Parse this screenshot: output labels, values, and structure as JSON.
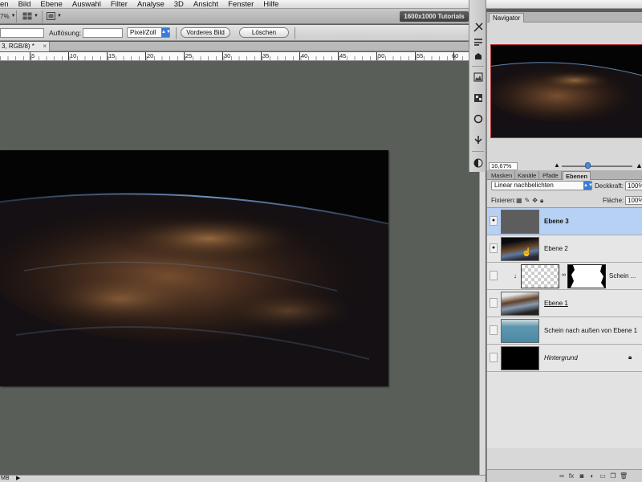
{
  "menu": [
    "en",
    "Bild",
    "Ebene",
    "Auswahl",
    "Filter",
    "Analyse",
    "3D",
    "Ansicht",
    "Fenster",
    "Hilfe"
  ],
  "appbar": {
    "zoom_fragment": "7%",
    "workspace_button": "1600x1000 Tutorials"
  },
  "options": {
    "resolution_label": "Auflösung:",
    "unit_select": "Pixel/Zoll",
    "front_image_button": "Vorderes Bild",
    "clear_button": "Löschen"
  },
  "document": {
    "tab_label": "3, RGB/8) *",
    "ruler_labels": [
      "5",
      "10",
      "15",
      "20",
      "25",
      "30",
      "35",
      "40",
      "45",
      "50",
      "55",
      "60"
    ]
  },
  "statusbar": {
    "text": "MB"
  },
  "navigator": {
    "tab": "Navigator",
    "zoom": "16,67%"
  },
  "layers_panel": {
    "tabs": [
      "Masken",
      "Kanäle",
      "Pfade",
      "Ebenen"
    ],
    "blend_mode": "Linear nachbelichten",
    "opacity_label": "Deckkraft:",
    "opacity_value": "100%",
    "lock_label": "Fixieren:",
    "fill_label": "Fläche:",
    "fill_value": "100%",
    "layers": [
      {
        "name": "Ebene 3",
        "selected": true,
        "visible": true
      },
      {
        "name": "Ebene 2",
        "selected": false,
        "visible": true
      },
      {
        "name": "Schein ...",
        "selected": false,
        "visible": false
      },
      {
        "name": "Ebene 1",
        "selected": false,
        "visible": false
      },
      {
        "name": "Schein nach außen von Ebene 1",
        "selected": false,
        "visible": false
      },
      {
        "name": "Hintergrund",
        "selected": false,
        "visible": false
      }
    ]
  },
  "colors": {
    "accent": "#3b7ad6",
    "selected_row": "#b7d1f5",
    "canvas_bg": "#5a5e58"
  }
}
